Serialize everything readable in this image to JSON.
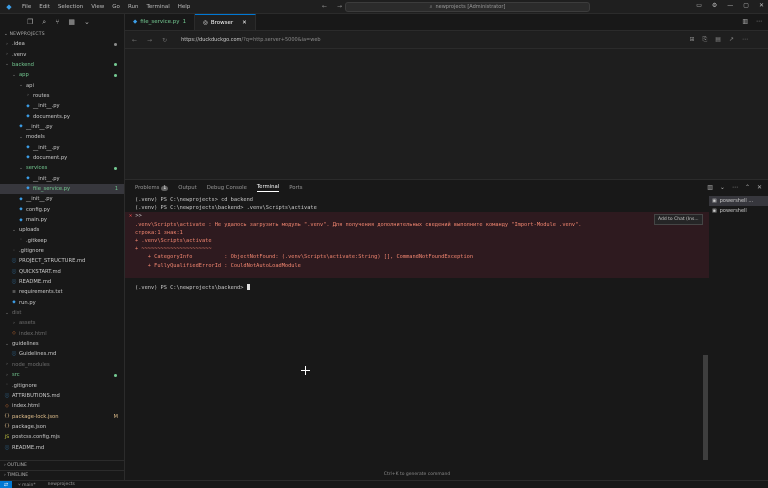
{
  "titlebar": {
    "menu": [
      "File",
      "Edit",
      "Selection",
      "View",
      "Go",
      "Run",
      "Terminal",
      "Help"
    ],
    "search_text": "newprojects [Administrator]"
  },
  "sidebar": {
    "section_title": "NEWPROJECTS",
    "tree": [
      {
        "label": ".idea",
        "depth": 0,
        "kind": "folder",
        "open": false,
        "tone": "norm",
        "badge": "dot"
      },
      {
        "label": ".venv",
        "depth": 0,
        "kind": "folder",
        "open": false,
        "tone": "norm",
        "badge": ""
      },
      {
        "label": "backend",
        "depth": 0,
        "kind": "folder",
        "open": true,
        "tone": "git",
        "badge": "dot"
      },
      {
        "label": "app",
        "depth": 1,
        "kind": "folder",
        "open": true,
        "tone": "git",
        "badge": "dot"
      },
      {
        "label": "api",
        "depth": 2,
        "kind": "folder",
        "open": true,
        "tone": "norm",
        "badge": ""
      },
      {
        "label": "routes",
        "depth": 3,
        "kind": "folder",
        "open": false,
        "tone": "norm",
        "badge": ""
      },
      {
        "label": "__init__.py",
        "depth": 3,
        "kind": "py",
        "open": false,
        "tone": "norm",
        "badge": ""
      },
      {
        "label": "documents.py",
        "depth": 3,
        "kind": "py",
        "open": false,
        "tone": "norm",
        "badge": ""
      },
      {
        "label": "__init__.py",
        "depth": 2,
        "kind": "py",
        "open": false,
        "tone": "norm",
        "badge": ""
      },
      {
        "label": "models",
        "depth": 2,
        "kind": "folder",
        "open": true,
        "tone": "norm",
        "badge": ""
      },
      {
        "label": "__init__.py",
        "depth": 3,
        "kind": "py",
        "open": false,
        "tone": "norm",
        "badge": ""
      },
      {
        "label": "document.py",
        "depth": 3,
        "kind": "py",
        "open": false,
        "tone": "norm",
        "badge": ""
      },
      {
        "label": "services",
        "depth": 2,
        "kind": "folder",
        "open": true,
        "tone": "git",
        "badge": "dot"
      },
      {
        "label": "__init__.py",
        "depth": 3,
        "kind": "py",
        "open": false,
        "tone": "norm",
        "badge": ""
      },
      {
        "label": "file_service.py",
        "depth": 3,
        "kind": "py",
        "open": false,
        "tone": "git",
        "badge": "1",
        "selected": true
      },
      {
        "label": "__init__.py",
        "depth": 2,
        "kind": "py",
        "open": false,
        "tone": "norm",
        "badge": ""
      },
      {
        "label": "config.py",
        "depth": 2,
        "kind": "py",
        "open": false,
        "tone": "norm",
        "badge": ""
      },
      {
        "label": "main.py",
        "depth": 2,
        "kind": "py",
        "open": false,
        "tone": "norm",
        "badge": ""
      },
      {
        "label": "uploads",
        "depth": 1,
        "kind": "folder",
        "open": true,
        "tone": "norm",
        "badge": ""
      },
      {
        "label": ".gitkeep",
        "depth": 2,
        "kind": "file",
        "open": false,
        "tone": "norm",
        "badge": ""
      },
      {
        "label": ".gitignore",
        "depth": 1,
        "kind": "file",
        "open": false,
        "tone": "norm",
        "badge": ""
      },
      {
        "label": "PROJECT_STRUCTURE.md",
        "depth": 1,
        "kind": "md",
        "open": false,
        "tone": "norm",
        "badge": ""
      },
      {
        "label": "QUICKSTART.md",
        "depth": 1,
        "kind": "md",
        "open": false,
        "tone": "norm",
        "badge": ""
      },
      {
        "label": "README.md",
        "depth": 1,
        "kind": "md",
        "open": false,
        "tone": "norm",
        "badge": ""
      },
      {
        "label": "requirements.txt",
        "depth": 1,
        "kind": "txt",
        "open": false,
        "tone": "norm",
        "badge": ""
      },
      {
        "label": "run.py",
        "depth": 1,
        "kind": "py",
        "open": false,
        "tone": "norm",
        "badge": ""
      },
      {
        "label": "dist",
        "depth": 0,
        "kind": "folder",
        "open": true,
        "tone": "dim",
        "badge": ""
      },
      {
        "label": "assets",
        "depth": 1,
        "kind": "folder",
        "open": false,
        "tone": "dim",
        "badge": ""
      },
      {
        "label": "index.html",
        "depth": 1,
        "kind": "html",
        "open": false,
        "tone": "dim",
        "badge": ""
      },
      {
        "label": "guidelines",
        "depth": 0,
        "kind": "folder",
        "open": true,
        "tone": "norm",
        "badge": ""
      },
      {
        "label": "Guidelines.md",
        "depth": 1,
        "kind": "md",
        "open": false,
        "tone": "norm",
        "badge": ""
      },
      {
        "label": "node_modules",
        "depth": 0,
        "kind": "folder",
        "open": false,
        "tone": "dim",
        "badge": ""
      },
      {
        "label": "src",
        "depth": 0,
        "kind": "folder",
        "open": false,
        "tone": "git",
        "badge": "dot"
      },
      {
        "label": ".gitignore",
        "depth": 0,
        "kind": "file",
        "open": false,
        "tone": "norm",
        "badge": ""
      },
      {
        "label": "ATTRIBUTIONS.md",
        "depth": 0,
        "kind": "md",
        "open": false,
        "tone": "norm",
        "badge": ""
      },
      {
        "label": "index.html",
        "depth": 0,
        "kind": "html",
        "open": false,
        "tone": "norm",
        "badge": ""
      },
      {
        "label": "package-lock.json",
        "depth": 0,
        "kind": "json",
        "open": false,
        "tone": "mod",
        "badge": "M"
      },
      {
        "label": "package.json",
        "depth": 0,
        "kind": "json",
        "open": false,
        "tone": "norm",
        "badge": ""
      },
      {
        "label": "postcss.config.mjs",
        "depth": 0,
        "kind": "js",
        "open": false,
        "tone": "norm",
        "badge": ""
      },
      {
        "label": "README.md",
        "depth": 0,
        "kind": "md",
        "open": false,
        "tone": "norm",
        "badge": ""
      }
    ],
    "outline_label": "OUTLINE",
    "timeline_label": "TIMELINE"
  },
  "tabs": [
    {
      "label": "file_service.py",
      "badge": "1",
      "active": false
    },
    {
      "label": "Browser",
      "badge": "",
      "active": true
    }
  ],
  "browser": {
    "url_host": "https://duckduckgo.com",
    "url_rest": "/?q=http.server+5000&ia=web"
  },
  "panel": {
    "tabs": [
      {
        "label": "Problems",
        "count": "1",
        "active": false
      },
      {
        "label": "Output",
        "count": "",
        "active": false
      },
      {
        "label": "Debug Console",
        "count": "",
        "active": false
      },
      {
        "label": "Terminal",
        "count": "",
        "active": true
      },
      {
        "label": "Ports",
        "count": "",
        "active": false
      }
    ],
    "terminal_lines": [
      {
        "text": "(.venv) PS C:\\newprojects> cd backend",
        "style": "normal"
      },
      {
        "text": "(.venv) PS C:\\newprojects\\backend> .venv\\Scripts\\activate",
        "style": "normal"
      },
      {
        "text": ">>",
        "style": "err-first"
      },
      {
        "text": ".venv\\Scripts\\activate : Не удалось загрузить модуль \".venv\". Для получения дополнительных сведений выполните команду \"Import-Module .venv\".",
        "style": "red"
      },
      {
        "text": "строка:1 знак:1",
        "style": "red"
      },
      {
        "text": "+ .venv\\Scripts\\activate",
        "style": "red"
      },
      {
        "text": "+ ~~~~~~~~~~~~~~~~~~~~~~",
        "style": "red"
      },
      {
        "text": "    + CategoryInfo          : ObjectNotFound: (.venv\\Scripts\\activate:String) [], CommandNotFoundException",
        "style": "red"
      },
      {
        "text": "    + FullyQualifiedErrorId : CouldNotAutoLoadModule",
        "style": "red"
      },
      {
        "text": "",
        "style": "red"
      },
      {
        "text": "(.venv) PS C:\\newprojects\\backend> ",
        "style": "prompt"
      }
    ],
    "hover_chip": "Add to Chat (Ins...",
    "terminals": [
      {
        "label": "powershell ...",
        "active": true
      },
      {
        "label": "powershell",
        "active": false
      }
    ],
    "generate_hint": "Ctrl+K to generate command"
  },
  "statusbar": {
    "branch": "main*",
    "project": "newprojects"
  },
  "colors": {
    "accent": "#0078d4",
    "error_text": "#f48771",
    "git_added": "#73c991",
    "git_modified": "#e2c08d"
  }
}
